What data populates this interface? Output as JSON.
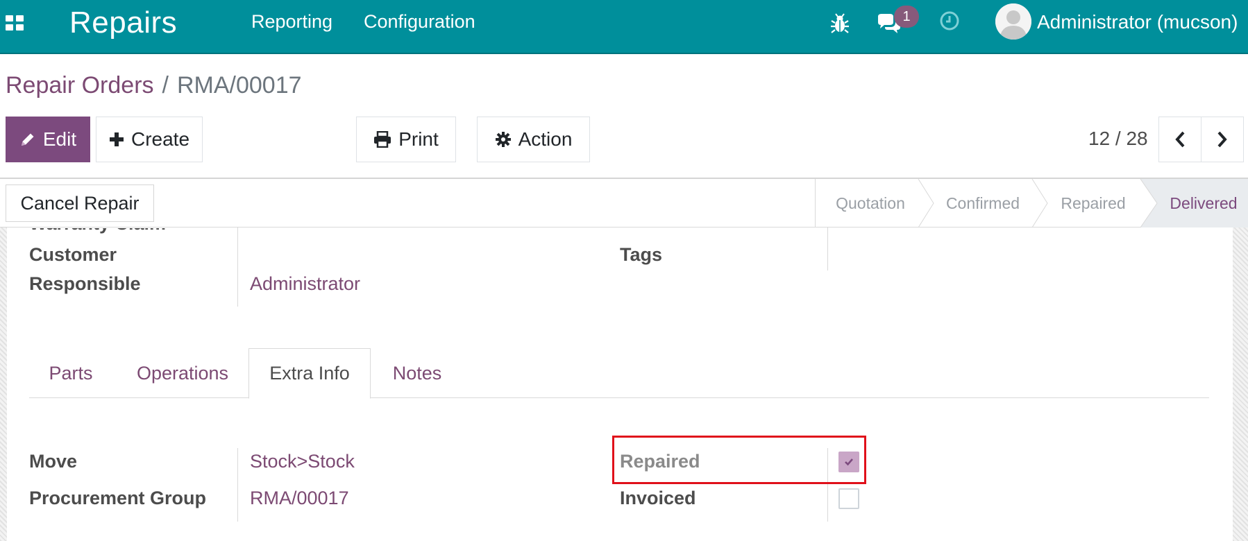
{
  "navbar": {
    "app_title": "Repairs",
    "menu": [
      "Reporting",
      "Configuration"
    ],
    "message_count": "1",
    "user_name": "Administrator (mucson)",
    "background_color": "#008f9b"
  },
  "breadcrumb": {
    "parent": "Repair Orders",
    "separator": "/",
    "current": "RMA/00017"
  },
  "toolbar": {
    "edit_label": "Edit",
    "create_label": "Create",
    "print_label": "Print",
    "action_label": "Action",
    "pager": "12 / 28"
  },
  "statusbar": {
    "cancel_label": "Cancel Repair",
    "stages": [
      "Quotation",
      "Confirmed",
      "Repaired",
      "Delivered"
    ],
    "active_stage": "Delivered"
  },
  "form": {
    "partial_label": "Warranty Claim",
    "customer_label": "Customer",
    "customer_value": "",
    "responsible_label": "Responsible",
    "responsible_value": "Administrator",
    "tags_label": "Tags",
    "tags_value": ""
  },
  "tabs": [
    "Parts",
    "Operations",
    "Extra Info",
    "Notes"
  ],
  "active_tab": "Extra Info",
  "extra_info": {
    "move_label": "Move",
    "move_value": "Stock>Stock",
    "procurement_label": "Procurement Group",
    "procurement_value": "RMA/00017",
    "repaired_label": "Repaired",
    "repaired_checked": true,
    "invoiced_label": "Invoiced",
    "invoiced_checked": false
  },
  "colors": {
    "primary": "#7c4a7e",
    "link": "#7c4a73",
    "highlight": "#e0101a"
  }
}
